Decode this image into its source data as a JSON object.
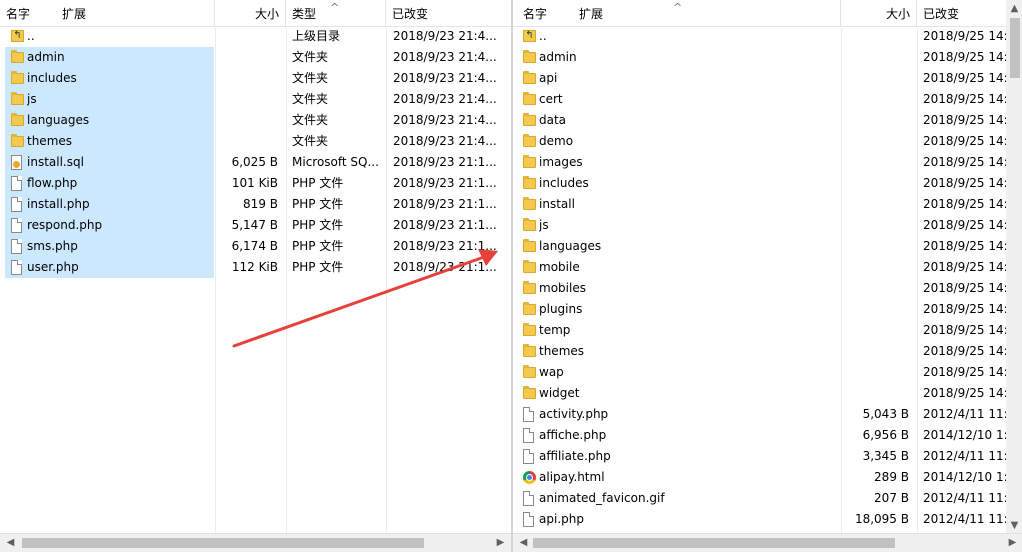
{
  "left": {
    "columns": {
      "name": "名字",
      "ext": "扩展",
      "size": "大小",
      "type": "类型",
      "modified": "已改变"
    },
    "rows": [
      {
        "name": "..",
        "size": "",
        "type": "上级目录",
        "modified": "2018/9/23  21:4...",
        "icon": "parent-folder-icon",
        "selected": false
      },
      {
        "name": "admin",
        "size": "",
        "type": "文件夹",
        "modified": "2018/9/23  21:4...",
        "icon": "folder-icon",
        "selected": true
      },
      {
        "name": "includes",
        "size": "",
        "type": "文件夹",
        "modified": "2018/9/23  21:4...",
        "icon": "folder-icon",
        "selected": true
      },
      {
        "name": "js",
        "size": "",
        "type": "文件夹",
        "modified": "2018/9/23  21:4...",
        "icon": "folder-icon",
        "selected": true
      },
      {
        "name": "languages",
        "size": "",
        "type": "文件夹",
        "modified": "2018/9/23  21:4...",
        "icon": "folder-icon",
        "selected": true
      },
      {
        "name": "themes",
        "size": "",
        "type": "文件夹",
        "modified": "2018/9/23  21:4...",
        "icon": "folder-icon",
        "selected": true
      },
      {
        "name": "install.sql",
        "size": "6,025 B",
        "type": "Microsoft SQ...",
        "modified": "2018/9/23  21:1...",
        "icon": "sql-file-icon",
        "selected": true
      },
      {
        "name": "flow.php",
        "size": "101 KiB",
        "type": "PHP 文件",
        "modified": "2018/9/23  21:1...",
        "icon": "file-icon",
        "selected": true
      },
      {
        "name": "install.php",
        "size": "819 B",
        "type": "PHP 文件",
        "modified": "2018/9/23  21:1...",
        "icon": "file-icon",
        "selected": true
      },
      {
        "name": "respond.php",
        "size": "5,147 B",
        "type": "PHP 文件",
        "modified": "2018/9/23  21:1...",
        "icon": "file-icon",
        "selected": true
      },
      {
        "name": "sms.php",
        "size": "6,174 B",
        "type": "PHP 文件",
        "modified": "2018/9/23  21:1...",
        "icon": "file-icon",
        "selected": true
      },
      {
        "name": "user.php",
        "size": "112 KiB",
        "type": "PHP 文件",
        "modified": "2018/9/23  21:1...",
        "icon": "file-icon",
        "selected": true
      }
    ]
  },
  "right": {
    "columns": {
      "name": "名字",
      "ext": "扩展",
      "size": "大小",
      "modified": "已改变"
    },
    "rows": [
      {
        "name": "..",
        "size": "",
        "modified": "2018/9/25  14:",
        "icon": "parent-folder-icon"
      },
      {
        "name": "admin",
        "size": "",
        "modified": "2018/9/25  14:",
        "icon": "folder-icon"
      },
      {
        "name": "api",
        "size": "",
        "modified": "2018/9/25  14:",
        "icon": "folder-icon"
      },
      {
        "name": "cert",
        "size": "",
        "modified": "2018/9/25  14:",
        "icon": "folder-icon"
      },
      {
        "name": "data",
        "size": "",
        "modified": "2018/9/25  14:",
        "icon": "folder-icon"
      },
      {
        "name": "demo",
        "size": "",
        "modified": "2018/9/25  14:",
        "icon": "folder-icon"
      },
      {
        "name": "images",
        "size": "",
        "modified": "2018/9/25  14:",
        "icon": "folder-icon"
      },
      {
        "name": "includes",
        "size": "",
        "modified": "2018/9/25  14:",
        "icon": "folder-icon"
      },
      {
        "name": "install",
        "size": "",
        "modified": "2018/9/25  14:",
        "icon": "folder-icon"
      },
      {
        "name": "js",
        "size": "",
        "modified": "2018/9/25  14:",
        "icon": "folder-icon"
      },
      {
        "name": "languages",
        "size": "",
        "modified": "2018/9/25  14:",
        "icon": "folder-icon"
      },
      {
        "name": "mobile",
        "size": "",
        "modified": "2018/9/25  14:",
        "icon": "folder-icon"
      },
      {
        "name": "mobiles",
        "size": "",
        "modified": "2018/9/25  14:",
        "icon": "folder-icon"
      },
      {
        "name": "plugins",
        "size": "",
        "modified": "2018/9/25  14:",
        "icon": "folder-icon"
      },
      {
        "name": "temp",
        "size": "",
        "modified": "2018/9/25  14:",
        "icon": "folder-icon"
      },
      {
        "name": "themes",
        "size": "",
        "modified": "2018/9/25  14:",
        "icon": "folder-icon"
      },
      {
        "name": "wap",
        "size": "",
        "modified": "2018/9/25  14:",
        "icon": "folder-icon"
      },
      {
        "name": "widget",
        "size": "",
        "modified": "2018/9/25  14:",
        "icon": "folder-icon"
      },
      {
        "name": "activity.php",
        "size": "5,043 B",
        "modified": "2012/4/11  11:",
        "icon": "file-icon"
      },
      {
        "name": "affiche.php",
        "size": "6,956 B",
        "modified": "2014/12/10  1:",
        "icon": "file-icon"
      },
      {
        "name": "affiliate.php",
        "size": "3,345 B",
        "modified": "2012/4/11  11:",
        "icon": "file-icon"
      },
      {
        "name": "alipay.html",
        "size": "289 B",
        "modified": "2014/12/10  1:",
        "icon": "chrome-icon"
      },
      {
        "name": "animated_favicon.gif",
        "size": "207 B",
        "modified": "2012/4/11  11:",
        "icon": "file-icon"
      },
      {
        "name": "api.php",
        "size": "18,095 B",
        "modified": "2012/4/11  11:",
        "icon": "file-icon"
      }
    ]
  },
  "annotation": {
    "arrow_color": "#e8403a"
  },
  "scroll": {
    "left_visible_fraction": 0.86,
    "right_h_visible_fraction": 0.8,
    "right_v_visible_fraction": 0.12
  }
}
